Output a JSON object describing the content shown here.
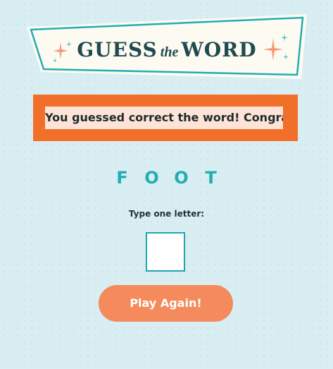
{
  "banner": {
    "title_part1": "GUESS",
    "title_part2": "the",
    "title_part3": "WORD",
    "left_icon": "sparkle-icon",
    "right_icon": "sparkle-icon"
  },
  "message": {
    "text": "You guessed correct the word! Congrats!"
  },
  "word": {
    "letters": [
      "F",
      "O",
      "O",
      "T"
    ]
  },
  "input": {
    "label": "Type one letter:",
    "value": ""
  },
  "actions": {
    "play_again_label": "Play Again!"
  },
  "colors": {
    "background": "#d9eef2",
    "teal_accent": "#20aeb3",
    "orange_box": "#f26f2a",
    "message_bg": "#fde4d6",
    "button": "#f58a5c",
    "title_text": "#1f4a50"
  }
}
